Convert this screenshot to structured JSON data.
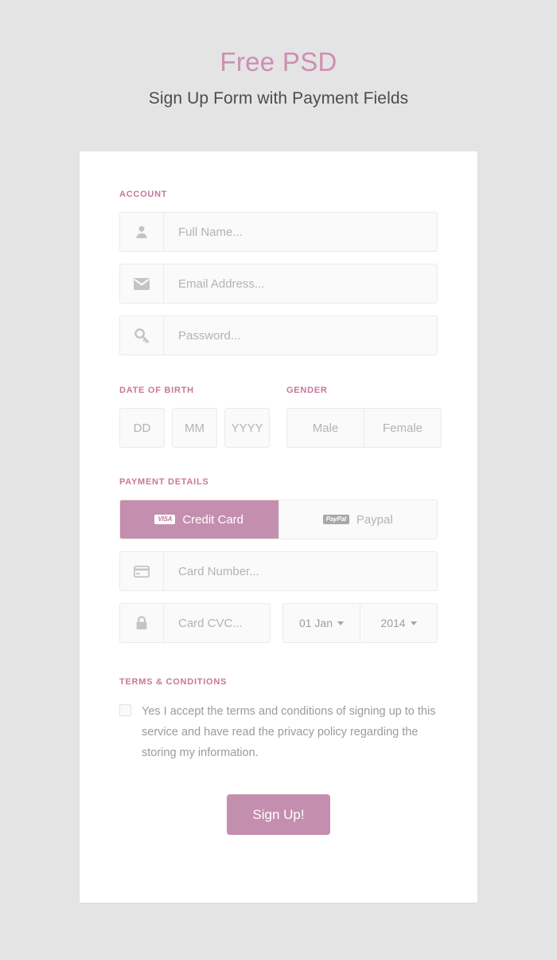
{
  "header": {
    "title": "Free PSD",
    "subtitle": "Sign Up Form with Payment Fields",
    "title_color": "#cd8fb2"
  },
  "theme": {
    "page_background": "#e4e4e4",
    "card_background": "#ffffff",
    "accent_pink": "#c48fae",
    "label_pink": "#c8779c",
    "placeholder_gray": "#b3b3b3",
    "field_background": "#fafafa",
    "field_border": "#eaeaea"
  },
  "account": {
    "label": "ACCOUNT",
    "fields": [
      {
        "icon": "user-icon",
        "placeholder": "Full Name...",
        "value": ""
      },
      {
        "icon": "envelope-icon",
        "placeholder": "Email Address...",
        "value": ""
      },
      {
        "icon": "key-icon",
        "placeholder": "Password...",
        "value": ""
      }
    ]
  },
  "date_of_birth": {
    "label": "DATE OF BIRTH",
    "fields": [
      {
        "placeholder": "DD",
        "value": ""
      },
      {
        "placeholder": "MM",
        "value": ""
      },
      {
        "placeholder": "YYYY",
        "value": ""
      }
    ]
  },
  "gender": {
    "label": "GENDER",
    "options": [
      {
        "label": "Male",
        "selected": false
      },
      {
        "label": "Female",
        "selected": false
      }
    ]
  },
  "payment": {
    "label": "PAYMENT DETAILS",
    "methods": [
      {
        "label": "Credit Card",
        "badge": "VISA",
        "badge_icon": "visa-logo-icon",
        "selected": true
      },
      {
        "label": "Paypal",
        "badge": "PayPal",
        "badge_icon": "paypal-logo-icon",
        "selected": false
      }
    ],
    "card_number": {
      "icon": "credit-card-icon",
      "placeholder": "Card Number...",
      "value": ""
    },
    "card_cvc": {
      "icon": "lock-icon",
      "placeholder": "Card CVC...",
      "value": ""
    },
    "expiry_month": {
      "value": "01 Jan",
      "icon": "chevron-down-icon"
    },
    "expiry_year": {
      "value": "2014",
      "icon": "chevron-down-icon"
    }
  },
  "terms": {
    "label": "TERMS & CONDITIONS",
    "checkbox_checked": false,
    "text": "Yes I accept the terms and conditions of signing up to this service and have read the privacy policy regarding the storing my information."
  },
  "submit": {
    "label": "Sign Up!"
  }
}
